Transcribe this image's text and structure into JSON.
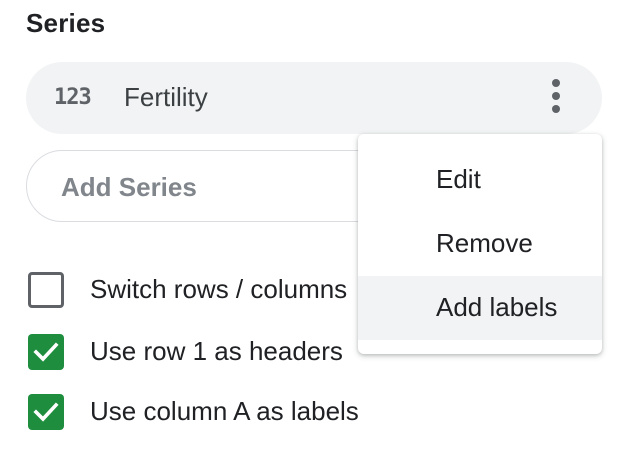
{
  "series_section": {
    "title": "Series",
    "series": [
      {
        "type_icon_text": "123",
        "label": "Fertility"
      }
    ],
    "more_icon": "more-vert-icon",
    "add_series_placeholder": "Add Series"
  },
  "options": [
    {
      "label": "Switch rows / columns",
      "checked": false
    },
    {
      "label": "Use row 1 as headers",
      "checked": true
    },
    {
      "label": "Use column A as labels",
      "checked": true
    }
  ],
  "context_menu": {
    "items": [
      {
        "label": "Edit"
      },
      {
        "label": "Remove"
      },
      {
        "label": "Add labels",
        "hovered": true
      }
    ]
  },
  "colors": {
    "checkbox_checked": "#1e8e3e",
    "chip_background": "#f1f3f4",
    "menu_hover": "#f1f3f4"
  }
}
